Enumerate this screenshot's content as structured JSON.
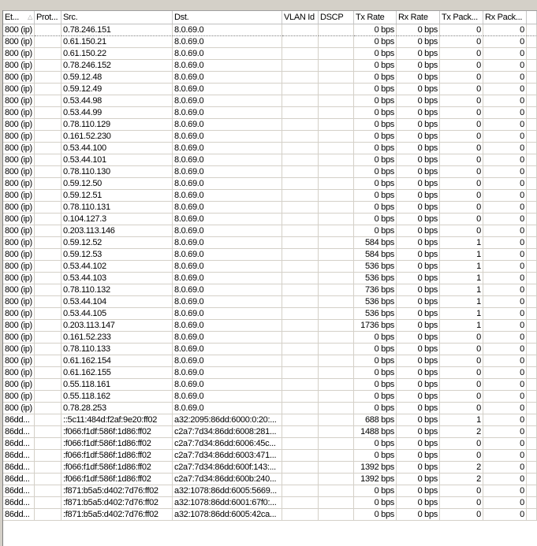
{
  "columns": [
    "Et...",
    "Prot...",
    "Src.",
    "Dst.",
    "VLAN Id",
    "DSCP",
    "Tx Rate",
    "Rx Rate",
    "Tx Pack...",
    "Rx Pack..."
  ],
  "sort_icon": "triangle-up",
  "rows": [
    [
      "800 (ip)",
      "",
      "0.78.246.151",
      "8.0.69.0",
      "",
      "",
      "0 bps",
      "0 bps",
      "0",
      "0"
    ],
    [
      "800 (ip)",
      "",
      "0.61.150.21",
      "8.0.69.0",
      "",
      "",
      "0 bps",
      "0 bps",
      "0",
      "0"
    ],
    [
      "800 (ip)",
      "",
      "0.61.150.22",
      "8.0.69.0",
      "",
      "",
      "0 bps",
      "0 bps",
      "0",
      "0"
    ],
    [
      "800 (ip)",
      "",
      "0.78.246.152",
      "8.0.69.0",
      "",
      "",
      "0 bps",
      "0 bps",
      "0",
      "0"
    ],
    [
      "800 (ip)",
      "",
      "0.59.12.48",
      "8.0.69.0",
      "",
      "",
      "0 bps",
      "0 bps",
      "0",
      "0"
    ],
    [
      "800 (ip)",
      "",
      "0.59.12.49",
      "8.0.69.0",
      "",
      "",
      "0 bps",
      "0 bps",
      "0",
      "0"
    ],
    [
      "800 (ip)",
      "",
      "0.53.44.98",
      "8.0.69.0",
      "",
      "",
      "0 bps",
      "0 bps",
      "0",
      "0"
    ],
    [
      "800 (ip)",
      "",
      "0.53.44.99",
      "8.0.69.0",
      "",
      "",
      "0 bps",
      "0 bps",
      "0",
      "0"
    ],
    [
      "800 (ip)",
      "",
      "0.78.110.129",
      "8.0.69.0",
      "",
      "",
      "0 bps",
      "0 bps",
      "0",
      "0"
    ],
    [
      "800 (ip)",
      "",
      "0.161.52.230",
      "8.0.69.0",
      "",
      "",
      "0 bps",
      "0 bps",
      "0",
      "0"
    ],
    [
      "800 (ip)",
      "",
      "0.53.44.100",
      "8.0.69.0",
      "",
      "",
      "0 bps",
      "0 bps",
      "0",
      "0"
    ],
    [
      "800 (ip)",
      "",
      "0.53.44.101",
      "8.0.69.0",
      "",
      "",
      "0 bps",
      "0 bps",
      "0",
      "0"
    ],
    [
      "800 (ip)",
      "",
      "0.78.110.130",
      "8.0.69.0",
      "",
      "",
      "0 bps",
      "0 bps",
      "0",
      "0"
    ],
    [
      "800 (ip)",
      "",
      "0.59.12.50",
      "8.0.69.0",
      "",
      "",
      "0 bps",
      "0 bps",
      "0",
      "0"
    ],
    [
      "800 (ip)",
      "",
      "0.59.12.51",
      "8.0.69.0",
      "",
      "",
      "0 bps",
      "0 bps",
      "0",
      "0"
    ],
    [
      "800 (ip)",
      "",
      "0.78.110.131",
      "8.0.69.0",
      "",
      "",
      "0 bps",
      "0 bps",
      "0",
      "0"
    ],
    [
      "800 (ip)",
      "",
      "0.104.127.3",
      "8.0.69.0",
      "",
      "",
      "0 bps",
      "0 bps",
      "0",
      "0"
    ],
    [
      "800 (ip)",
      "",
      "0.203.113.146",
      "8.0.69.0",
      "",
      "",
      "0 bps",
      "0 bps",
      "0",
      "0"
    ],
    [
      "800 (ip)",
      "",
      "0.59.12.52",
      "8.0.69.0",
      "",
      "",
      "584 bps",
      "0 bps",
      "1",
      "0"
    ],
    [
      "800 (ip)",
      "",
      "0.59.12.53",
      "8.0.69.0",
      "",
      "",
      "584 bps",
      "0 bps",
      "1",
      "0"
    ],
    [
      "800 (ip)",
      "",
      "0.53.44.102",
      "8.0.69.0",
      "",
      "",
      "536 bps",
      "0 bps",
      "1",
      "0"
    ],
    [
      "800 (ip)",
      "",
      "0.53.44.103",
      "8.0.69.0",
      "",
      "",
      "536 bps",
      "0 bps",
      "1",
      "0"
    ],
    [
      "800 (ip)",
      "",
      "0.78.110.132",
      "8.0.69.0",
      "",
      "",
      "736 bps",
      "0 bps",
      "1",
      "0"
    ],
    [
      "800 (ip)",
      "",
      "0.53.44.104",
      "8.0.69.0",
      "",
      "",
      "536 bps",
      "0 bps",
      "1",
      "0"
    ],
    [
      "800 (ip)",
      "",
      "0.53.44.105",
      "8.0.69.0",
      "",
      "",
      "536 bps",
      "0 bps",
      "1",
      "0"
    ],
    [
      "800 (ip)",
      "",
      "0.203.113.147",
      "8.0.69.0",
      "",
      "",
      "1736 bps",
      "0 bps",
      "1",
      "0"
    ],
    [
      "800 (ip)",
      "",
      "0.161.52.233",
      "8.0.69.0",
      "",
      "",
      "0 bps",
      "0 bps",
      "0",
      "0"
    ],
    [
      "800 (ip)",
      "",
      "0.78.110.133",
      "8.0.69.0",
      "",
      "",
      "0 bps",
      "0 bps",
      "0",
      "0"
    ],
    [
      "800 (ip)",
      "",
      "0.61.162.154",
      "8.0.69.0",
      "",
      "",
      "0 bps",
      "0 bps",
      "0",
      "0"
    ],
    [
      "800 (ip)",
      "",
      "0.61.162.155",
      "8.0.69.0",
      "",
      "",
      "0 bps",
      "0 bps",
      "0",
      "0"
    ],
    [
      "800 (ip)",
      "",
      "0.55.118.161",
      "8.0.69.0",
      "",
      "",
      "0 bps",
      "0 bps",
      "0",
      "0"
    ],
    [
      "800 (ip)",
      "",
      "0.55.118.162",
      "8.0.69.0",
      "",
      "",
      "0 bps",
      "0 bps",
      "0",
      "0"
    ],
    [
      "800 (ip)",
      "",
      "0.78.28.253",
      "8.0.69.0",
      "",
      "",
      "0 bps",
      "0 bps",
      "0",
      "0"
    ],
    [
      "86dd...",
      "",
      "::5c11:484d:f2af:9e20:ff02",
      "a32:2095:86dd:6000:0:20:...",
      "",
      "",
      "688 bps",
      "0 bps",
      "1",
      "0"
    ],
    [
      "86dd...",
      "",
      ":f066:f1df:586f:1d86:ff02",
      "c2a7:7d34:86dd:6008:281...",
      "",
      "",
      "1488 bps",
      "0 bps",
      "2",
      "0"
    ],
    [
      "86dd...",
      "",
      ":f066:f1df:586f:1d86:ff02",
      "c2a7:7d34:86dd:6006:45c...",
      "",
      "",
      "0 bps",
      "0 bps",
      "0",
      "0"
    ],
    [
      "86dd...",
      "",
      ":f066:f1df:586f:1d86:ff02",
      "c2a7:7d34:86dd:6003:471...",
      "",
      "",
      "0 bps",
      "0 bps",
      "0",
      "0"
    ],
    [
      "86dd...",
      "",
      ":f066:f1df:586f:1d86:ff02",
      "c2a7:7d34:86dd:600f:143:...",
      "",
      "",
      "1392 bps",
      "0 bps",
      "2",
      "0"
    ],
    [
      "86dd...",
      "",
      ":f066:f1df:586f:1d86:ff02",
      "c2a7:7d34:86dd:600b:240...",
      "",
      "",
      "1392 bps",
      "0 bps",
      "2",
      "0"
    ],
    [
      "86dd...",
      "",
      ":f871:b5a5:d402:7d76:ff02",
      "a32:1078:86dd:6005:5669...",
      "",
      "",
      "0 bps",
      "0 bps",
      "0",
      "0"
    ],
    [
      "86dd...",
      "",
      ":f871:b5a5:d402:7d76:ff02",
      "a32:1078:86dd:6001:67f0:...",
      "",
      "",
      "0 bps",
      "0 bps",
      "0",
      "0"
    ],
    [
      "86dd...",
      "",
      ":f871:b5a5:d402:7d76:ff02",
      "a32:1078:86dd:6005:42ca...",
      "",
      "",
      "0 bps",
      "0 bps",
      "0",
      "0"
    ]
  ]
}
